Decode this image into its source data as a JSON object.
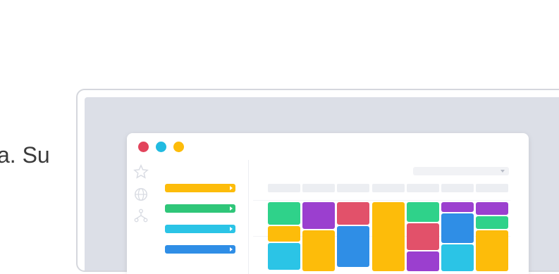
{
  "page": {
    "fragment_text": "a. Su"
  },
  "window": {
    "dots": [
      {
        "name": "close-dot",
        "color": "#e2445c"
      },
      {
        "name": "minimize-dot",
        "color": "#21bbe1"
      },
      {
        "name": "maximize-dot",
        "color": "#fdbc0a"
      }
    ],
    "rail_icons": [
      "star-icon",
      "globe-icon",
      "org-chart-icon"
    ],
    "menu_items": [
      {
        "name": "menu-item-1",
        "color": "#fdbc0a"
      },
      {
        "name": "menu-item-2",
        "color": "#2fc679"
      },
      {
        "name": "menu-item-3",
        "color": "#2bc4e6"
      },
      {
        "name": "menu-item-4",
        "color": "#2f8ee6"
      }
    ],
    "columns": [
      [
        {
          "color": "#2fd28a",
          "h": 34
        },
        {
          "color": "#fdbc0a",
          "h": 24
        },
        {
          "color": "#2bc4e6",
          "h": 40
        }
      ],
      [
        {
          "color": "#9b3fcf",
          "h": 40
        },
        {
          "color": "#fdbc0a",
          "h": 60
        }
      ],
      [
        {
          "color": "#e2516a",
          "h": 34
        },
        {
          "color": "#2f8ee6",
          "h": 60
        }
      ],
      [
        {
          "color": "#fdbc0a",
          "h": 100
        }
      ],
      [
        {
          "color": "#2fd28a",
          "h": 30
        },
        {
          "color": "#e2516a",
          "h": 40
        },
        {
          "color": "#9b3fcf",
          "h": 30
        }
      ],
      [
        {
          "color": "#9b3fcf",
          "h": 16
        },
        {
          "color": "#2f8ee6",
          "h": 44
        },
        {
          "color": "#2bc4e6",
          "h": 40
        }
      ],
      [
        {
          "color": "#9b3fcf",
          "h": 20
        },
        {
          "color": "#2fd28a",
          "h": 20
        },
        {
          "color": "#fdbc0a",
          "h": 60
        }
      ]
    ]
  }
}
